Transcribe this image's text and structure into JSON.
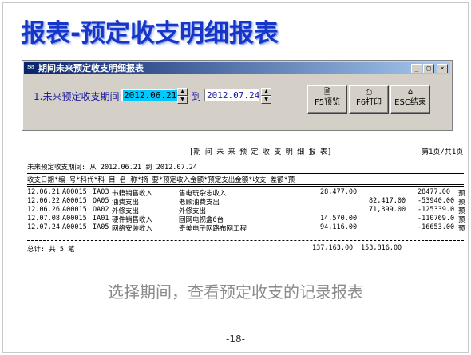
{
  "slide": {
    "title": "报表-预定收支明细报表",
    "caption": "选择期间，查看预定收支的记录报表",
    "page_number": "-18-"
  },
  "window": {
    "title": "期间未来预定收支明细报表",
    "icon": "app-icon",
    "controls": [
      "_",
      "□",
      "×"
    ]
  },
  "form": {
    "period_label": "1.未来预定收支期间:",
    "start_date": "2012.06.21",
    "to_label": "到",
    "end_date": "2012.07.24"
  },
  "buttons": {
    "preview": {
      "label": "F5预览",
      "icon": "document-preview-icon"
    },
    "print": {
      "label": "F6打印",
      "icon": "printer-icon"
    },
    "exit": {
      "label": "ESC结束",
      "icon": "exit-icon"
    }
  },
  "report": {
    "title": "[期 间 未 来 预 定 收 支 明 细 报 表]",
    "page": "第1页/共1页",
    "period_line": "未来预定收支期间: 从 2012.06.21 到 2012.07.24",
    "header": "收支日期*编  号*科代*科     目     名     称*摘                                  要*预定收入金额*预定支出金额*收支 差额*预",
    "rows": [
      {
        "date": "12.06.21",
        "no": "A00015",
        "code": "IA03",
        "subject": "书籍销售收入",
        "memo": "售电玩杂志收入",
        "income": "28,477.00",
        "expense": "",
        "diff": "28477.00",
        "flag": "预"
      },
      {
        "date": "12.06.22",
        "no": "A00015",
        "code": "OA05",
        "subject": "油费支出",
        "memo": "老顾油费支出",
        "income": "",
        "expense": "82,417.00",
        "diff": "-53940.00",
        "flag": "预"
      },
      {
        "date": "12.06.26",
        "no": "A00015",
        "code": "OA02",
        "subject": "外修支出",
        "memo": "外修支出",
        "income": "",
        "expense": "71,399.00",
        "diff": "-125339.0",
        "flag": "预"
      },
      {
        "date": "12.07.08",
        "no": "A00015",
        "code": "IA01",
        "subject": "硬件销售收入",
        "memo": "回网电视盒6台",
        "income": "14,570.00",
        "expense": "",
        "diff": "-110769.0",
        "flag": "预"
      },
      {
        "date": "12.07.24",
        "no": "A00015",
        "code": "IA05",
        "subject": "网络安装收入",
        "memo": "奇美电子网路布网工程",
        "income": "94,116.00",
        "expense": "",
        "diff": "-16653.00",
        "flag": "预"
      }
    ],
    "total_label": "总计: 共 5 笔",
    "total_income": "137,163.00",
    "total_expense": "153,816.00"
  }
}
